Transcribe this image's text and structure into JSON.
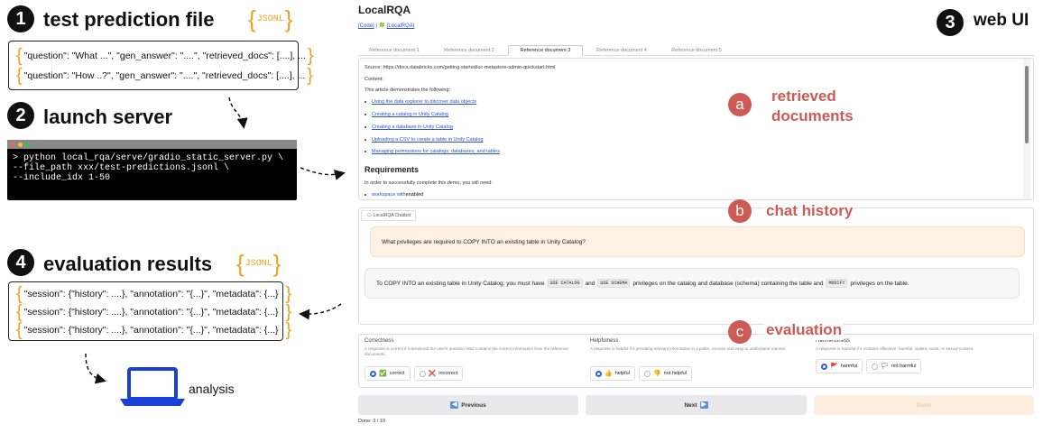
{
  "pipeline": {
    "steps": [
      {
        "number": "1",
        "title": "test prediction file"
      },
      {
        "number": "2",
        "title": "launch server"
      },
      {
        "number": "3",
        "title": "web UI"
      },
      {
        "number": "4",
        "title": "evaluation results"
      }
    ],
    "jsonl_tag": "JSONL",
    "prediction_lines": [
      "\"question\": \"What ...\", \"gen_answer\": \"....\", \"retrieved_docs\": [....], ...",
      "\"question\": \"How ..?\", \"gen_answer\": \"....\", \"retrieved_docs\": [....], ..."
    ],
    "terminal_command": "> python local_rqa/serve/gradio_static_server.py \\\n--file_path xxx/test-predictions.jsonl \\\n--include_idx 1-50",
    "result_lines": [
      "\"session\": {\"history\": ....}, \"annotation\": \"{...}\", \"metadata\": {...}",
      "\"session\": {\"history\": ....}, \"annotation\": \"{...}\", \"metadata\": {...}",
      "\"session\": {\"history\": ....}, \"annotation\": \"{...}\", \"metadata\": {...}"
    ],
    "analysis_label": "analysis"
  },
  "app": {
    "title": "LocalRQA",
    "link_code": "[Code]",
    "link_sep": " | ",
    "link_localrqa": "[LocalRQA]",
    "tabs": [
      "Reference document 1",
      "Reference document 2",
      "Reference document 3",
      "Reference document 4",
      "Reference document 5"
    ],
    "active_tab": 2,
    "document": {
      "source": "Source: https://docs.databricks.com/getting-started/uc-metastore-admin-quickstart.html",
      "content_label": "Content:",
      "intro": "This article demonstrates the following:",
      "bullets": [
        "Using the data explorer to discover data objects",
        "Creating a catalog in Unity Catalog",
        "Creating a database in Unity Catalog",
        "Uploading a CSV to create a table in Unity Catalog",
        "Managing permissions for catalogs, databases, and tables"
      ],
      "heading": "Requirements",
      "req_intro": "In order to successfully complete this demo, you will need:",
      "req_bullet_link": "workspace with",
      "req_bullet_rest": " enabled"
    },
    "chatbot_label": "LocalRQA Chatbot",
    "user_message": "What privileges are required to COPY INTO an existing table in Unity Catalog?",
    "bot_message": {
      "p1": "To COPY INTO an existing table in Unity Catalog, you must have",
      "c1": "USE CATALOG",
      "p2": "and",
      "c2": "USE SCHEMA",
      "p3": "privileges on the catalog and database (schema) containing the table and",
      "c3": "MODIFY",
      "p4": "privileges on the table."
    },
    "evaluation": [
      {
        "name": "Correctness",
        "desc": "A response is correct if it answered the user's question AND contains the correct information from the reference documents.",
        "options": [
          {
            "icon": "✅",
            "label": "correct",
            "selected": true
          },
          {
            "icon": "❌",
            "label": "incorrect",
            "selected": false
          }
        ]
      },
      {
        "name": "Helpfulness",
        "desc": "A response is helpful if it providing relevant information in a polite, concise and easy to understand manner.",
        "options": [
          {
            "icon": "👍",
            "label": "helpful",
            "selected": true
          },
          {
            "icon": "👎",
            "label": "not helpful",
            "selected": false
          }
        ]
      },
      {
        "name": "Harmlessness",
        "desc": "A response is harmful if it contains offensive, harmful, violent, racist, or sexual content.",
        "options": [
          {
            "icon": "🚩",
            "label": "harmful",
            "selected": true
          },
          {
            "icon": "🏳",
            "label": "not harmful",
            "selected": false
          }
        ]
      }
    ],
    "buttons": {
      "previous": "Previous",
      "next": "Next",
      "done": "Done"
    },
    "done_count": "Done: 3 / 10"
  },
  "callouts": [
    {
      "letter": "a",
      "text": "retrieved\ndocuments"
    },
    {
      "letter": "b",
      "text": "chat history"
    },
    {
      "letter": "c",
      "text": "evaluation"
    }
  ],
  "colors": {
    "accent_orange": "#f0a020",
    "callout_red": "#cc5a55",
    "link_blue": "#2b52cc"
  }
}
